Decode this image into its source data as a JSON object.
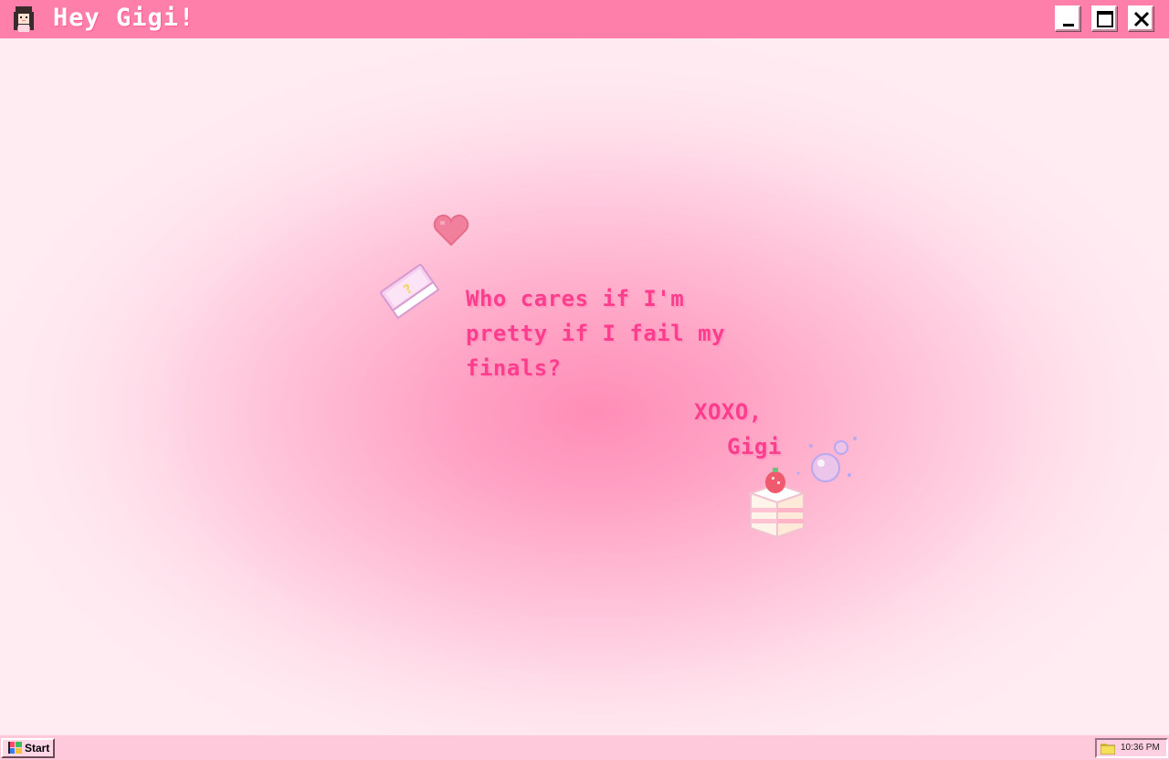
{
  "window": {
    "title": "Hey Gigi!",
    "avatar_icon": "girl-avatar-icon",
    "controls": {
      "minimize_icon": "minimize-icon",
      "maximize_icon": "maximize-icon",
      "close_icon": "close-icon"
    }
  },
  "note": {
    "lines": [
      "Who cares if I'm",
      "pretty if I fail my",
      "finals?"
    ],
    "signoff": "XOXO,",
    "signature": "Gigi"
  },
  "stickers": {
    "book": "book-icon",
    "heart": "heart-icon",
    "cake": "strawberry-cake-icon",
    "bubbles": "bubbles-icon"
  },
  "taskbar": {
    "start_label": "Start",
    "clock": "10:36 PM",
    "tray_icon": "folder-icon"
  },
  "colors": {
    "titlebar": "#ff7fab",
    "text_accent": "#ff3d8d",
    "taskbar": "#ffc9dc",
    "desktop_center": "#ff8db6",
    "desktop_edge": "#ffe8f0"
  }
}
